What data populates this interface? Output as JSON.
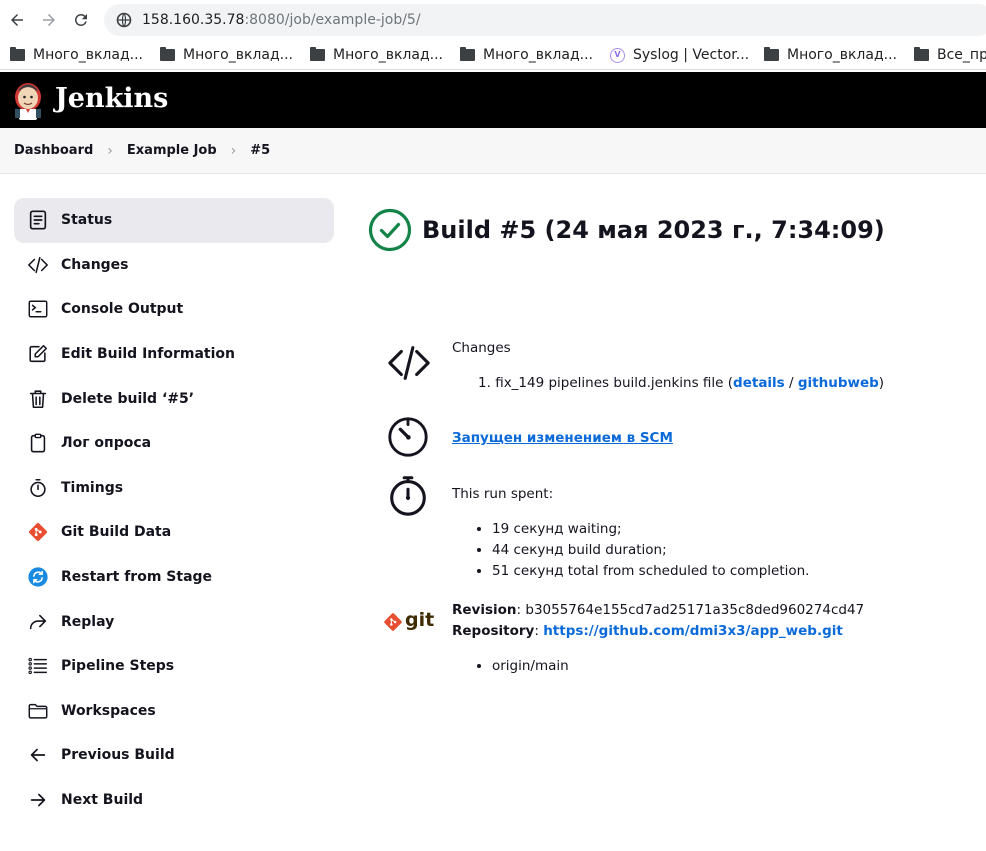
{
  "browser": {
    "url_host": "158.160.35.78",
    "url_path": ":8080/job/example-job/5/",
    "bookmarks": [
      {
        "label": "Много_вклад...",
        "icon": "folder-icon"
      },
      {
        "label": "Много_вклад...",
        "icon": "folder-icon"
      },
      {
        "label": "Много_вклад...",
        "icon": "folder-icon"
      },
      {
        "label": "Много_вклад...",
        "icon": "folder-icon"
      },
      {
        "label": "Syslog | Vector...",
        "icon": "vector-icon"
      },
      {
        "label": "Много_вклад...",
        "icon": "folder-icon"
      },
      {
        "label": "Все_пр",
        "icon": "folder-icon"
      }
    ]
  },
  "header": {
    "title": "Jenkins"
  },
  "breadcrumb": [
    "Dashboard",
    "Example Job",
    "#5"
  ],
  "sidebar": {
    "items": [
      {
        "label": "Status",
        "icon": "status-icon",
        "active": true
      },
      {
        "label": "Changes",
        "icon": "code-icon"
      },
      {
        "label": "Console Output",
        "icon": "terminal-icon"
      },
      {
        "label": "Edit Build Information",
        "icon": "edit-icon"
      },
      {
        "label": "Delete build ‘#5’",
        "icon": "trash-icon"
      },
      {
        "label": "Лог опроса",
        "icon": "clipboard-icon"
      },
      {
        "label": "Timings",
        "icon": "stopwatch-icon"
      },
      {
        "label": "Git Build Data",
        "icon": "git-icon"
      },
      {
        "label": "Restart from Stage",
        "icon": "restart-icon"
      },
      {
        "label": "Replay",
        "icon": "replay-icon"
      },
      {
        "label": "Pipeline Steps",
        "icon": "list-icon"
      },
      {
        "label": "Workspaces",
        "icon": "folder-icon"
      },
      {
        "label": "Previous Build",
        "icon": "arrow-left-icon"
      },
      {
        "label": "Next Build",
        "icon": "arrow-right-icon"
      }
    ]
  },
  "main": {
    "title": "Build #5 (24 мая 2023 г., 7:34:09)",
    "changes": {
      "heading": "Changes",
      "item_number": "1.",
      "item_text": "fix_149 pipelines build.jenkins file (",
      "details_link": "details",
      "separator": " / ",
      "githubweb_link": "githubweb",
      "close": ")"
    },
    "trigger": {
      "link": "Запущен изменением в SCM"
    },
    "timing": {
      "heading": "This run spent:",
      "items": [
        "19 секунд waiting;",
        "44 секунд build duration;",
        "51 секунд total from scheduled to completion."
      ]
    },
    "git": {
      "logo_text": "git",
      "revision_label": "Revision",
      "revision_value": ": b3055764e155cd7ad25171a35c8ded960274cd47",
      "repository_label": "Repository",
      "repository_sep": ": ",
      "repository_url": "https://github.com/dmi3x3/app_web.git",
      "branches": [
        "origin/main"
      ]
    }
  }
}
